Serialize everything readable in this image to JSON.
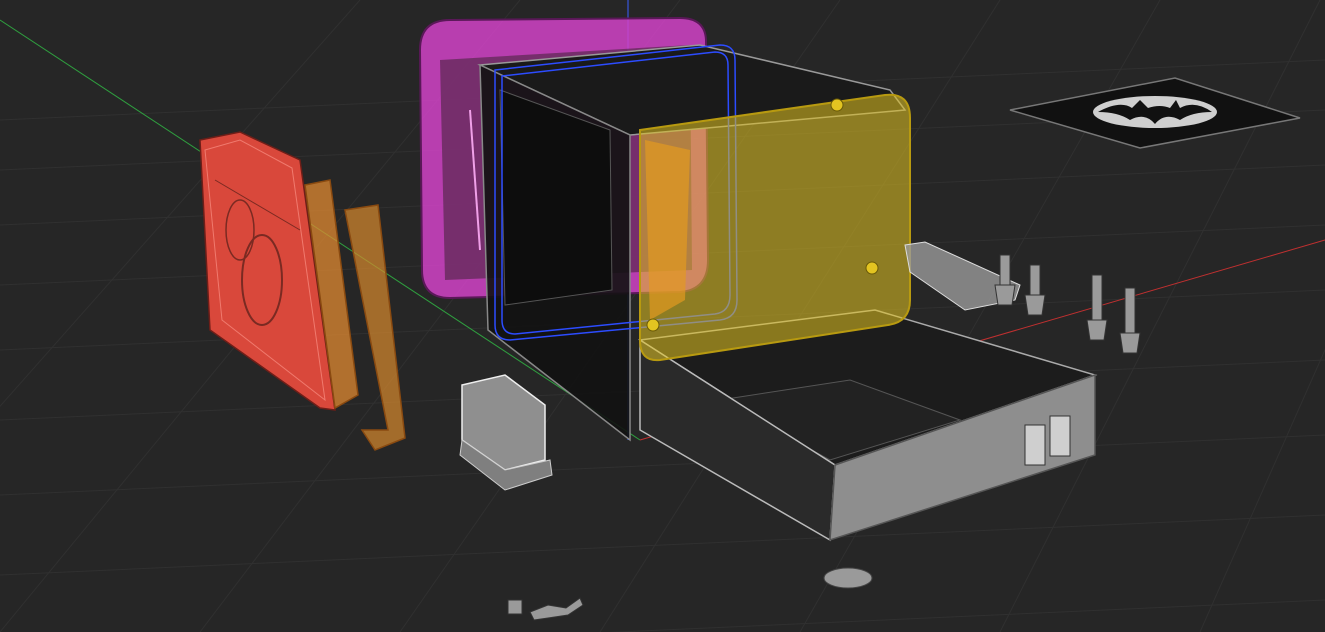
{
  "viewport": {
    "type": "3d-cad-viewport",
    "background": "#262626",
    "grid_color": "#333333",
    "axis_colors": {
      "x": "#c03030",
      "y": "#2f9e3f",
      "z": "#3b5fff"
    }
  },
  "parts": [
    {
      "name": "hard-drive",
      "color": "#d9483b"
    },
    {
      "name": "drive-bracket-front",
      "color": "#e08a32"
    },
    {
      "name": "drive-bracket-rear",
      "color": "#d98a2e"
    },
    {
      "name": "rear-panel",
      "color": "#d243c8"
    },
    {
      "name": "case-shell",
      "color": "#1a1a1a"
    },
    {
      "name": "inner-frame",
      "color": "#2c4cff"
    },
    {
      "name": "front-panel",
      "color": "#e3c421"
    },
    {
      "name": "drawer-tray",
      "color": "#8e8e8e"
    },
    {
      "name": "side-rail",
      "color": "#9a9a9a"
    },
    {
      "name": "standoff-screws",
      "color": "#9a9a9a"
    },
    {
      "name": "fan-duct",
      "color": "#9a9a9a"
    },
    {
      "name": "small-screw",
      "color": "#9a9a9a"
    },
    {
      "name": "clip",
      "color": "#9a9a9a"
    },
    {
      "name": "logo-badge",
      "color": "#111111"
    }
  ]
}
